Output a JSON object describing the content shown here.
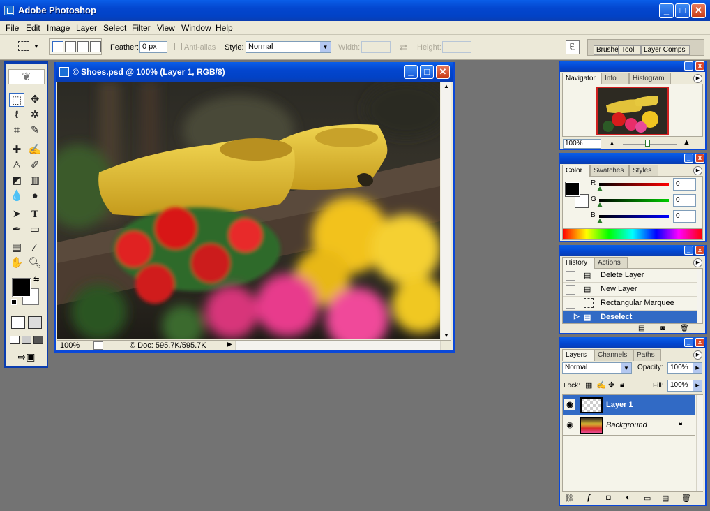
{
  "app": {
    "title": "Adobe Photoshop"
  },
  "menu": [
    "File",
    "Edit",
    "Image",
    "Layer",
    "Select",
    "Filter",
    "View",
    "Window",
    "Help"
  ],
  "options": {
    "feather_label": "Feather:",
    "feather_value": "0 px",
    "antialias_label": "Anti-alias",
    "style_label": "Style:",
    "style_value": "Normal",
    "width_label": "Width:",
    "height_label": "Height:",
    "well_tabs": [
      "Brushes",
      "Tool Presets",
      "Layer Comps"
    ]
  },
  "document": {
    "title": "© Shoes.psd @ 100% (Layer 1, RGB/8)",
    "zoom": "100%",
    "doc_info": "© Doc: 595.7K/595.7K"
  },
  "navigator": {
    "tabs": [
      "Navigator",
      "Info",
      "Histogram"
    ],
    "zoom": "100%"
  },
  "color": {
    "tabs": [
      "Color",
      "Swatches",
      "Styles"
    ],
    "channels": [
      {
        "label": "R",
        "value": "0",
        "color": "#e02020"
      },
      {
        "label": "G",
        "value": "0",
        "color": "#20c020"
      },
      {
        "label": "B",
        "value": "0",
        "color": "#2020e0"
      }
    ]
  },
  "history": {
    "tabs": [
      "History",
      "Actions"
    ],
    "items": [
      "Delete Layer",
      "New Layer",
      "Rectangular Marquee",
      "Deselect"
    ]
  },
  "layers": {
    "tabs": [
      "Layers",
      "Channels",
      "Paths"
    ],
    "blend_mode": "Normal",
    "opacity_label": "Opacity:",
    "opacity": "100%",
    "lock_label": "Lock:",
    "fill_label": "Fill:",
    "fill": "100%",
    "items": [
      "Layer 1",
      "Background"
    ]
  },
  "colors": {
    "accent": "#316ac5",
    "titlebar": "#0a48d8",
    "panel_bg": "#ece9d8"
  }
}
